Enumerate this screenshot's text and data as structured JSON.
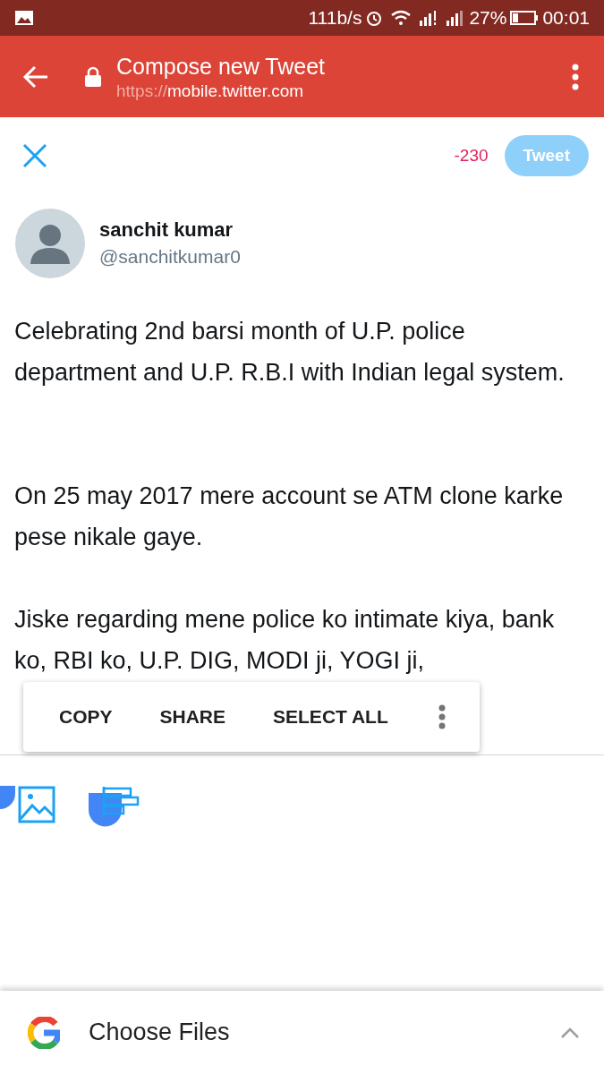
{
  "status_bar": {
    "speed": "111b/s",
    "battery": "27%",
    "time": "00:01"
  },
  "toolbar": {
    "title": "Compose new Tweet",
    "url_scheme": "https://",
    "url_host": "mobile.twitter.com"
  },
  "compose": {
    "counter": "-230",
    "tweet_button": {
      "label": "Tweet",
      "disabled": true
    }
  },
  "author": {
    "name": "sanchit kumar",
    "handle": "@sanchitkumar0"
  },
  "tweet_paragraphs": [
    "Celebrating 2nd barsi month of U.P. police department and U.P. R.B.I with Indian legal system.",
    "On 25 may 2017 mere account se ATM clone karke pese nikale gaye.",
    "Jiske regarding mene police ko intimate kiya, bank ko, RBI ko, U.P. DIG, MODI ji, YOGI ji,"
  ],
  "text_menu": [
    "COPY",
    "SHARE",
    "SELECT ALL"
  ],
  "file_chooser": {
    "label": "Choose Files"
  }
}
